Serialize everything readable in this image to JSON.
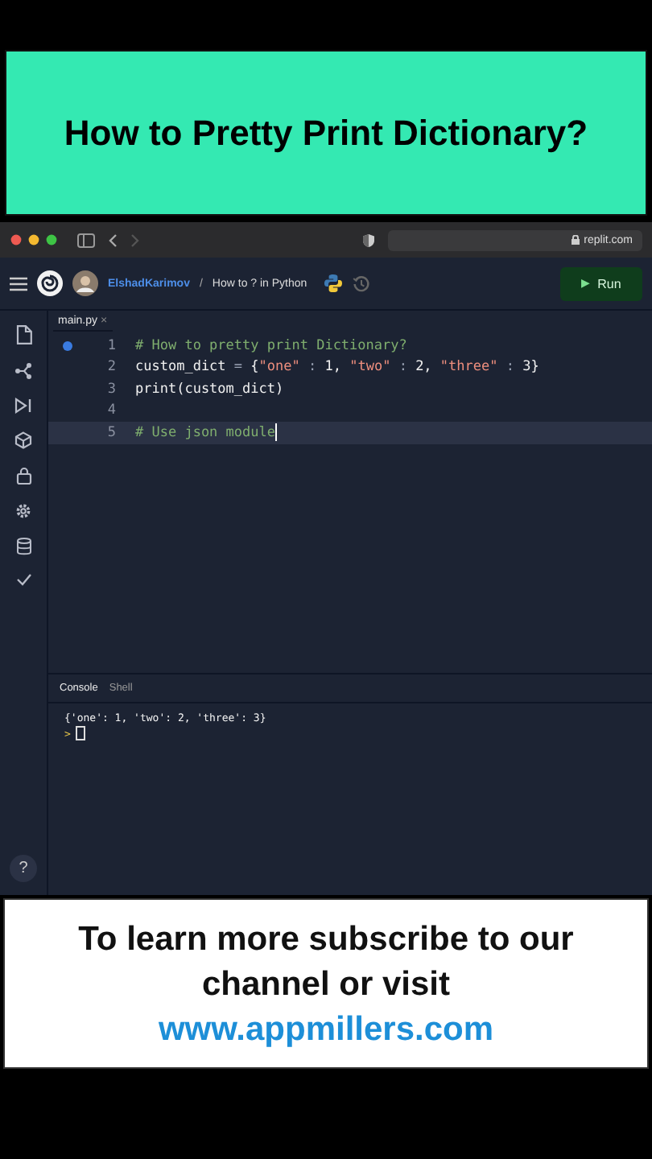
{
  "banner": {
    "title": "How to Pretty Print Dictionary?"
  },
  "browser": {
    "url": "replit.com"
  },
  "header": {
    "user": "ElshadKarimov",
    "separator": "/",
    "repl": "How to ? in Python",
    "run_icon": "▶",
    "run_label": "Run"
  },
  "editor": {
    "tabs": [
      {
        "label": "main.py",
        "close": "×",
        "selected": true
      }
    ],
    "lines": [
      {
        "number": "1",
        "breakpoint": true,
        "current": false,
        "tokens": [
          {
            "kind": "comment",
            "text": "# How to pretty print Dictionary?"
          }
        ]
      },
      {
        "number": "2",
        "breakpoint": false,
        "current": false,
        "tokens": [
          {
            "kind": "plain",
            "text": "custom_dict "
          },
          {
            "kind": "op",
            "text": "="
          },
          {
            "kind": "plain",
            "text": " {"
          },
          {
            "kind": "string",
            "text": "\"one\""
          },
          {
            "kind": "op",
            "text": " : "
          },
          {
            "kind": "plain",
            "text": "1, "
          },
          {
            "kind": "string",
            "text": "\"two\""
          },
          {
            "kind": "op",
            "text": " : "
          },
          {
            "kind": "plain",
            "text": "2, "
          },
          {
            "kind": "string",
            "text": "\"three\""
          },
          {
            "kind": "op",
            "text": " : "
          },
          {
            "kind": "plain",
            "text": "3}"
          }
        ]
      },
      {
        "number": "3",
        "breakpoint": false,
        "current": false,
        "tokens": [
          {
            "kind": "plain",
            "text": "print(custom_dict)"
          }
        ]
      },
      {
        "number": "4",
        "breakpoint": false,
        "current": false
      },
      {
        "number": "5",
        "breakpoint": false,
        "current": true,
        "tokens": [
          {
            "kind": "comment",
            "text": "# Use json module"
          }
        ]
      }
    ]
  },
  "console": {
    "tabs": [
      {
        "label": "Console",
        "selected": true
      },
      {
        "label": "Shell",
        "selected": false
      }
    ],
    "output": [
      "{'one': 1, 'two': 2, 'three': 3}"
    ],
    "prompt": ">"
  },
  "help": "?",
  "footer": {
    "text": "To learn more subscribe to our channel or visit",
    "link": "www.appmillers.com"
  }
}
